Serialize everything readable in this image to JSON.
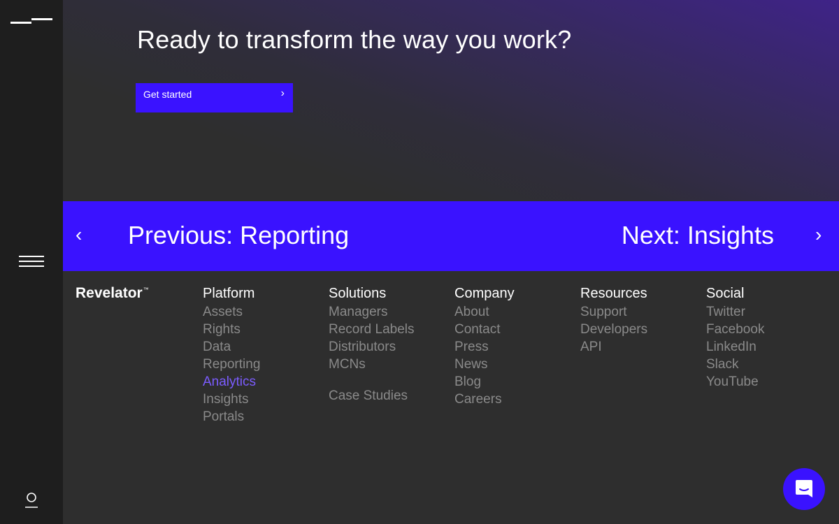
{
  "hero": {
    "title": "Ready to transform the way you work?",
    "cta_label": "Get started",
    "cta_chevron": "›"
  },
  "pager": {
    "prev_arrow": "‹",
    "prev_label": "Previous: Reporting",
    "next_label": "Next: Insights",
    "next_arrow": "›"
  },
  "footer": {
    "brand": "Revelator",
    "brand_tm": "™",
    "columns": [
      {
        "heading": "Platform",
        "links": [
          "Assets",
          "Rights",
          "Data",
          "Reporting",
          "Analytics",
          "Insights",
          "Portals"
        ]
      },
      {
        "heading": "Solutions",
        "links": [
          "Managers",
          "Record Labels",
          "Distributors",
          "MCNs",
          "Case Studies"
        ]
      },
      {
        "heading": "Company",
        "links": [
          "About",
          "Contact",
          "Press",
          "News",
          "Blog",
          "Careers"
        ]
      },
      {
        "heading": "Resources",
        "links": [
          "Support",
          "Developers",
          "API"
        ]
      },
      {
        "heading": "Social",
        "links": [
          "Twitter",
          "Facebook",
          "LinkedIn",
          "Slack",
          "YouTube"
        ]
      }
    ]
  },
  "icons": {
    "logo": "brand-logo-icon",
    "menu": "hamburger-menu-icon",
    "user": "user-icon",
    "chat": "chat-icon"
  },
  "colors": {
    "accent": "#3a12ff",
    "active_link": "#7b5cff",
    "background": "#2e2e2e",
    "sidebar": "#1e1e1e",
    "muted_link": "#8a8a8a"
  }
}
